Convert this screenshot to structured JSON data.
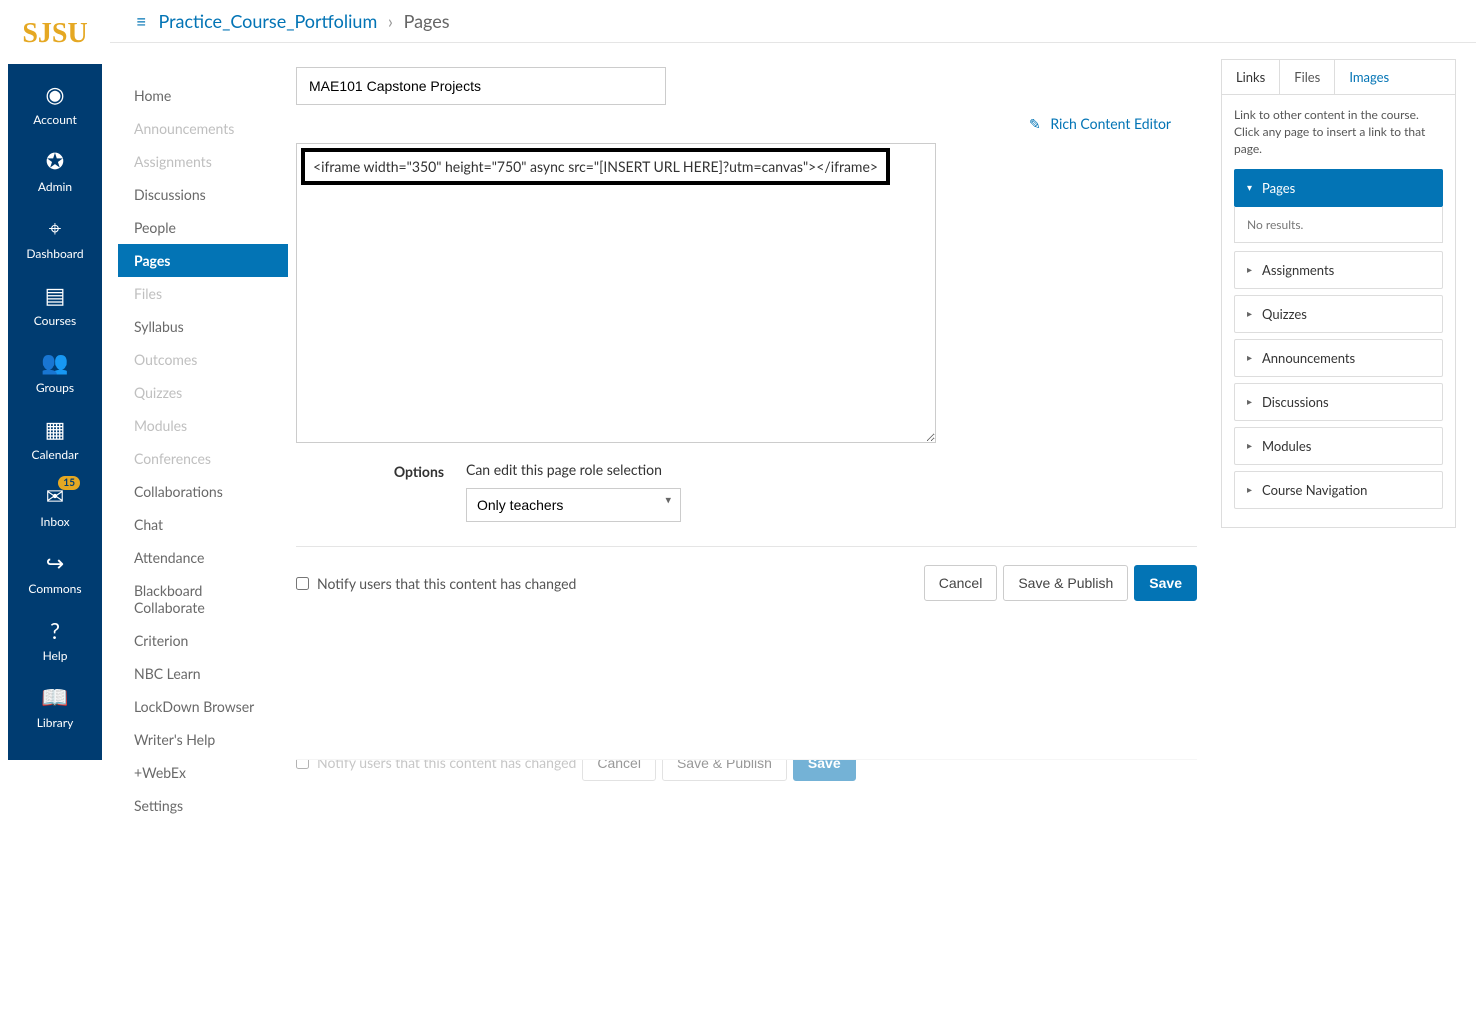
{
  "logo_text": "SJSU",
  "global_nav": [
    {
      "label": "Account",
      "icon": "◉"
    },
    {
      "label": "Admin",
      "icon": "✪"
    },
    {
      "label": "Dashboard",
      "icon": "⌖"
    },
    {
      "label": "Courses",
      "icon": "▤"
    },
    {
      "label": "Groups",
      "icon": "👥"
    },
    {
      "label": "Calendar",
      "icon": "▦"
    },
    {
      "label": "Inbox",
      "icon": "✉",
      "badge": "15"
    },
    {
      "label": "Commons",
      "icon": "↪"
    },
    {
      "label": "Help",
      "icon": "?"
    },
    {
      "label": "Library",
      "icon": "📖"
    }
  ],
  "breadcrumb": {
    "course": "Practice_Course_Portfolium",
    "page": "Pages"
  },
  "course_nav": [
    {
      "label": "Home"
    },
    {
      "label": "Announcements",
      "disabled": true
    },
    {
      "label": "Assignments",
      "disabled": true
    },
    {
      "label": "Discussions"
    },
    {
      "label": "People"
    },
    {
      "label": "Pages",
      "active": true
    },
    {
      "label": "Files",
      "disabled": true
    },
    {
      "label": "Syllabus"
    },
    {
      "label": "Outcomes",
      "disabled": true
    },
    {
      "label": "Quizzes",
      "disabled": true
    },
    {
      "label": "Modules",
      "disabled": true
    },
    {
      "label": "Conferences",
      "disabled": true
    },
    {
      "label": "Collaborations"
    },
    {
      "label": "Chat"
    },
    {
      "label": "Attendance"
    },
    {
      "label": "Blackboard Collaborate"
    },
    {
      "label": "Criterion"
    },
    {
      "label": "NBC Learn"
    },
    {
      "label": "LockDown Browser"
    },
    {
      "label": "Writer's Help"
    },
    {
      "label": "+WebEx"
    },
    {
      "label": "Settings"
    }
  ],
  "editor": {
    "title_value": "MAE101 Capstone Projects",
    "rce_toggle_label": "Rich Content Editor",
    "html_content": "<iframe width=\"350\" height=\"750\" async src=\"[INSERT URL HERE]?utm=canvas\"></iframe>",
    "options_label": "Options",
    "role_caption": "Can edit this page role selection",
    "role_selected": "Only teachers",
    "notify_label": "Notify users that this content has changed",
    "cancel": "Cancel",
    "save_publish": "Save & Publish",
    "save": "Save"
  },
  "side": {
    "tabs": [
      "Links",
      "Files",
      "Images"
    ],
    "active_tab": "Links",
    "help_text": "Link to other content in the course. Click any page to insert a link to that page.",
    "groups": [
      {
        "label": "Pages",
        "expanded": true,
        "empty": "No results."
      },
      {
        "label": "Assignments"
      },
      {
        "label": "Quizzes"
      },
      {
        "label": "Announcements"
      },
      {
        "label": "Discussions"
      },
      {
        "label": "Modules"
      },
      {
        "label": "Course Navigation"
      }
    ]
  }
}
